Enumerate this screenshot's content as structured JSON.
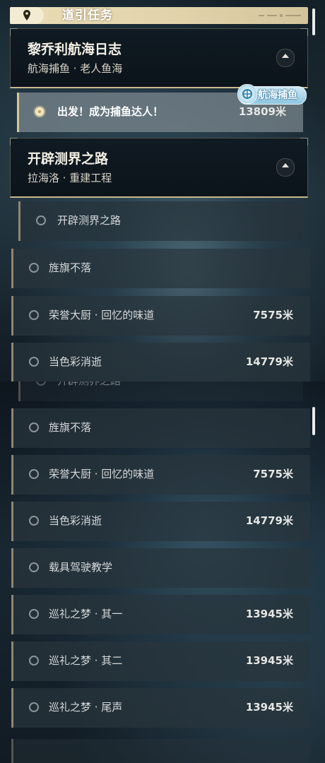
{
  "header": {
    "title": "道引任务",
    "icon": "map-pin-icon"
  },
  "top_panel": {
    "group1": {
      "title": "黎乔利航海日志",
      "subtitle": "航海捕鱼 · 老人鱼海"
    },
    "category_badge": {
      "label": "航海捕鱼",
      "icon": "fishing-compass-icon"
    },
    "active_task": {
      "label": "出发！成为捕鱼达人！",
      "distance": "13809米"
    },
    "group2": {
      "title": "开辟测界之路",
      "subtitle": "拉海洛 · 重建工程"
    },
    "tasks": [
      {
        "label": "开辟测界之路",
        "distance": ""
      },
      {
        "label": "旌旗不落",
        "distance": ""
      },
      {
        "label": "荣誉大厨 · 回忆的味道",
        "distance": "7575米"
      },
      {
        "label": "当色彩消逝",
        "distance": "14779米"
      }
    ]
  },
  "bottom_panel": {
    "ghost_label": "开辟测界之路",
    "tasks": [
      {
        "label": "旌旗不落",
        "distance": ""
      },
      {
        "label": "荣誉大厨 · 回忆的味道",
        "distance": "7575米"
      },
      {
        "label": "当色彩消逝",
        "distance": "14779米"
      },
      {
        "label": "载具驾驶教学",
        "distance": ""
      },
      {
        "label": "巡礼之梦 · 其一",
        "distance": "13945米"
      },
      {
        "label": "巡礼之梦 · 其二",
        "distance": "13945米"
      },
      {
        "label": "巡礼之梦 · 尾声",
        "distance": "13945米"
      }
    ]
  },
  "colors": {
    "accent_gold": "#d8c694",
    "badge_blue": "#8ec6df"
  }
}
